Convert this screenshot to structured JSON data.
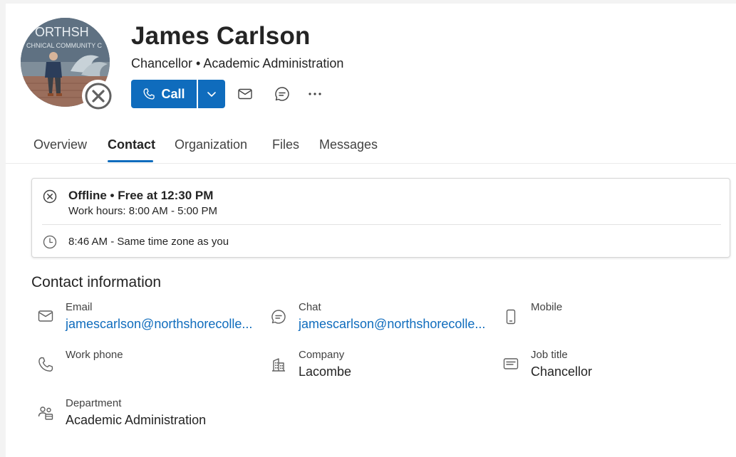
{
  "profile": {
    "name": "James Carlson",
    "subtitle": "Chancellor • Academic Administration",
    "avatar_text_top": "ORTHSH",
    "avatar_text_sub": "CHNICAL COMMUNITY C",
    "presence": "offline"
  },
  "actions": {
    "call_label": "Call",
    "icons": [
      "phone-icon",
      "chevron-down-icon",
      "mail-icon",
      "chat-icon",
      "more-icon"
    ]
  },
  "tabs": [
    {
      "label": "Overview",
      "active": false
    },
    {
      "label": "Contact",
      "active": true
    },
    {
      "label": "Organization",
      "active": false
    },
    {
      "label": "Files",
      "active": false
    },
    {
      "label": "Messages",
      "active": false
    }
  ],
  "status": {
    "headline": "Offline • Free at 12:30 PM",
    "work_hours": "Work hours: 8:00 AM - 5:00 PM",
    "local_time": "8:46 AM - Same time zone as you"
  },
  "contact": {
    "title": "Contact information",
    "email": {
      "label": "Email",
      "value": "jamescarlson@northshorecolle..."
    },
    "chat": {
      "label": "Chat",
      "value": "jamescarlson@northshorecolle..."
    },
    "mobile": {
      "label": "Mobile",
      "value": ""
    },
    "work_phone": {
      "label": "Work phone",
      "value": ""
    },
    "company": {
      "label": "Company",
      "value": "Lacombe"
    },
    "job_title": {
      "label": "Job title",
      "value": "Chancellor"
    },
    "department": {
      "label": "Department",
      "value": "Academic Administration"
    }
  },
  "colors": {
    "accent": "#0f6cbd",
    "text": "#242424",
    "subtle_text": "#424242",
    "icon": "#616161"
  }
}
